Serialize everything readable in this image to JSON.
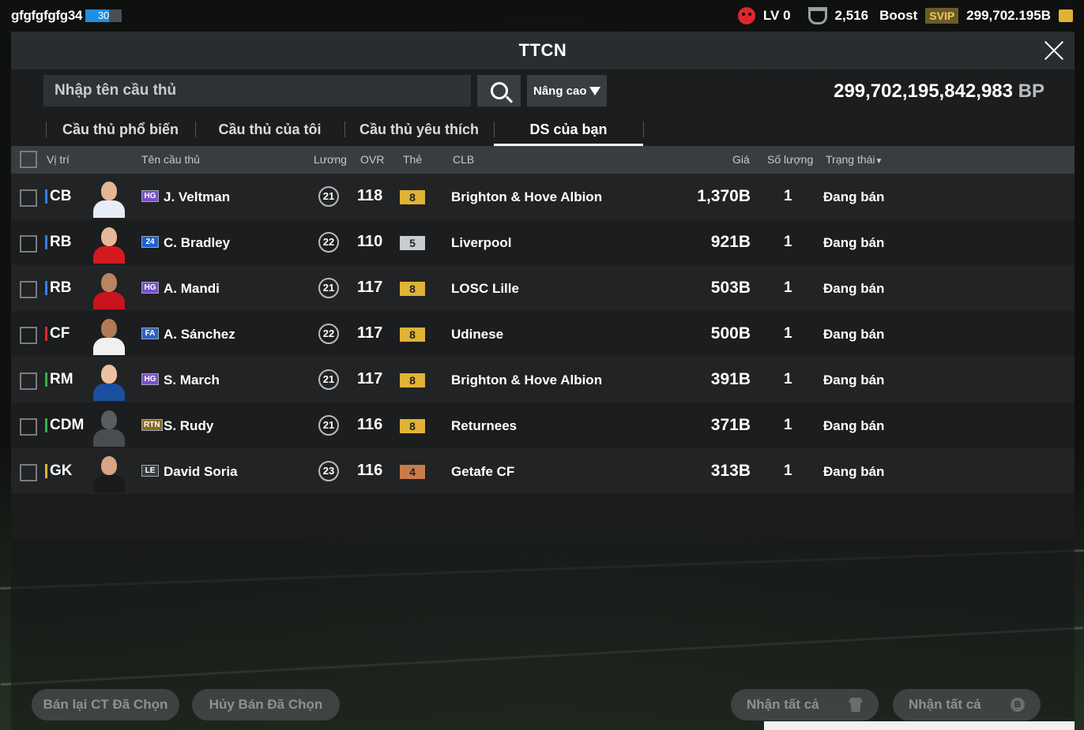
{
  "topbar": {
    "username": "gfgfgfgfg34",
    "level_badge": "30",
    "level_progress": 0.65,
    "lv_label": "LV 0",
    "cup_count": "2,516",
    "boost_label": "Boost",
    "svip_label": "SVIP",
    "coins": "299,702.195B"
  },
  "panel": {
    "title": "TTCN",
    "search_placeholder": "Nhập tên cầu thủ",
    "advanced_label": "Nâng cao",
    "bp_amount": "299,702,195,842,983",
    "bp_unit": "BP"
  },
  "tabs": [
    {
      "label": "Cầu thủ phổ biến",
      "active": false
    },
    {
      "label": "Cầu thủ của tôi",
      "active": false
    },
    {
      "label": "Cầu thủ yêu thích",
      "active": false
    },
    {
      "label": "DS của bạn",
      "active": true
    }
  ],
  "columns": {
    "position": "Vị trí",
    "name": "Tên cầu thủ",
    "wage": "Lương",
    "ovr": "OVR",
    "grade": "Thẻ",
    "club": "CLB",
    "price": "Giá",
    "quantity": "Số lượng",
    "status": "Trạng thái"
  },
  "players": [
    {
      "pos": "CB",
      "pos_color": "#2f7ff0",
      "season": "HG",
      "season_color": "#7a4fc9",
      "name": "J. Veltman",
      "wage": "21",
      "ovr": "118",
      "grade": "8",
      "grade_color": "#e0b336",
      "club": "Brighton & Hove Albion",
      "price": "1,370B",
      "qty": "1",
      "status": "Đang bán",
      "kit": "#e8eef6",
      "skin": "#e2b594"
    },
    {
      "pos": "RB",
      "pos_color": "#2f7ff0",
      "season": "24",
      "season_color": "#1f5fd6",
      "name": "C. Bradley",
      "wage": "22",
      "ovr": "110",
      "grade": "5",
      "grade_color": "#c7ccd1",
      "club": "Liverpool",
      "price": "921B",
      "qty": "1",
      "status": "Đang bán",
      "kit": "#d4191f",
      "skin": "#e5b898"
    },
    {
      "pos": "RB",
      "pos_color": "#2f7ff0",
      "season": "HG",
      "season_color": "#7a4fc9",
      "name": "A. Mandi",
      "wage": "21",
      "ovr": "117",
      "grade": "8",
      "grade_color": "#e0b336",
      "club": "LOSC Lille",
      "price": "503B",
      "qty": "1",
      "status": "Đang bán",
      "kit": "#c8141d",
      "skin": "#b98461"
    },
    {
      "pos": "CF",
      "pos_color": "#e0262d",
      "season": "FA",
      "season_color": "#2a63c7",
      "name": "A. Sánchez",
      "wage": "22",
      "ovr": "117",
      "grade": "8",
      "grade_color": "#e0b336",
      "club": "Udinese",
      "price": "500B",
      "qty": "1",
      "status": "Đang bán",
      "kit": "#f0f0f0",
      "skin": "#b07a57"
    },
    {
      "pos": "RM",
      "pos_color": "#2fb34a",
      "season": "HG",
      "season_color": "#7a4fc9",
      "name": "S. March",
      "wage": "21",
      "ovr": "117",
      "grade": "8",
      "grade_color": "#e0b336",
      "club": "Brighton & Hove Albion",
      "price": "391B",
      "qty": "1",
      "status": "Đang bán",
      "kit": "#1a4f9e",
      "skin": "#edc2a2"
    },
    {
      "pos": "CDM",
      "pos_color": "#2fb34a",
      "season": "RTN",
      "season_color": "#8a6a2a",
      "name": "S. Rudy",
      "wage": "21",
      "ovr": "116",
      "grade": "8",
      "grade_color": "#e0b336",
      "club": "Returnees",
      "price": "371B",
      "qty": "1",
      "status": "Đang bán",
      "kit": "#4a4d4f",
      "skin": "#5a5d5f"
    },
    {
      "pos": "GK",
      "pos_color": "#e0b336",
      "season": "LE",
      "season_color": "#3a3d40",
      "name": "David Soria",
      "wage": "23",
      "ovr": "116",
      "grade": "4",
      "grade_color": "#c97b4a",
      "club": "Getafe CF",
      "price": "313B",
      "qty": "1",
      "status": "Đang bán",
      "kit": "#1a1a1a",
      "skin": "#d7a584"
    }
  ],
  "buttons": {
    "resell": "Bán lại CT Đã Chọn",
    "cancel": "Hủy Bán Đã Chọn",
    "claim_players": "Nhận tất cả",
    "claim_bp": "Nhận tất cả"
  }
}
